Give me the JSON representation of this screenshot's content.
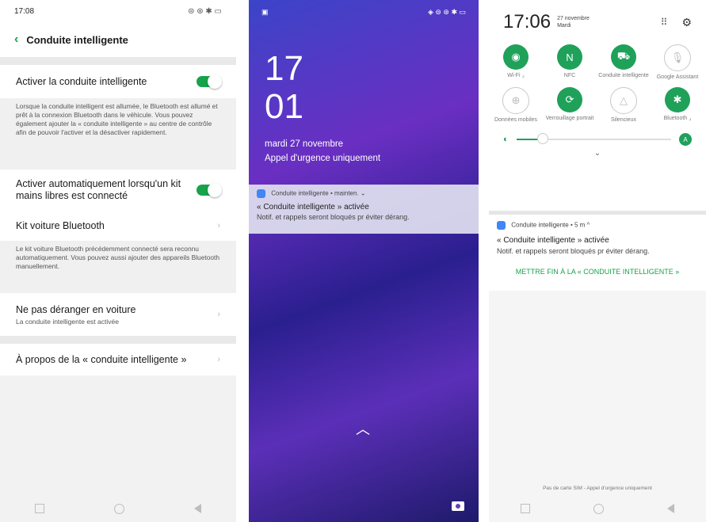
{
  "panel1": {
    "time": "17:08",
    "title": "Conduite intelligente",
    "toggle_label": "Activer la conduite intelligente",
    "toggle_desc": "Lorsque la conduite intelligent est allumée, le Bluetooth est allumé et prêt à la connexion Bluetooth dans le véhicule. Vous pouvez également ajouter la « conduite intelligente » au centre de contrôle afin de pouvoir l'activer et la désactiver rapidement.",
    "auto_label": "Activer automatiquement lorsqu'un kit mains libres est connecté",
    "kit_label": "Kit voiture Bluetooth",
    "kit_desc": "Le kit voiture Bluetooth précédemment connecté sera reconnu automatiquement. Vous pouvez aussi ajouter des appareils Bluetooth manuellement.",
    "dnd_label": "Ne pas déranger en voiture",
    "dnd_sub": "La conduite intelligente est activée",
    "about_label": "À propos de la « conduite intelligente »"
  },
  "panel2": {
    "hour": "17",
    "minute": "01",
    "date": "mardi 27 novembre",
    "emergency": "Appel d'urgence uniquement",
    "notif_header": "Conduite intelligente • mainten. ⌄",
    "notif_title": "« Conduite intelligente » activée",
    "notif_body": "Notif. et rappels seront bloqués pr éviter dérang."
  },
  "panel3": {
    "time": "17:06",
    "date": "27 novembre",
    "day": "Mardi",
    "tiles": [
      {
        "label": "Wi-Fi ⌟",
        "icon": "wifi-icon",
        "on": true,
        "glyph": "◉"
      },
      {
        "label": "NFC",
        "icon": "nfc-icon",
        "on": true,
        "glyph": "N"
      },
      {
        "label": "Conduite intelligente",
        "icon": "car-icon",
        "on": true,
        "glyph": "⛟"
      },
      {
        "label": "Google Assistant",
        "icon": "mic-icon",
        "on": false,
        "glyph": "🎙"
      },
      {
        "label": "Données mobiles",
        "icon": "globe-icon",
        "on": false,
        "glyph": "⊕"
      },
      {
        "label": "Verrouillage portrait",
        "icon": "rotation-lock-icon",
        "on": true,
        "glyph": "⟳"
      },
      {
        "label": "Silencieux",
        "icon": "bell-off-icon",
        "on": false,
        "glyph": "△"
      },
      {
        "label": "Bluetooth ⌟",
        "icon": "bluetooth-icon",
        "on": true,
        "glyph": "✱"
      }
    ],
    "brightness_auto": "A",
    "brightness_level": 0.17,
    "notif_header": "Conduite intelligente • 5 m ^",
    "notif_title": "« Conduite intelligente » activée",
    "notif_body": "Notif. et rappels seront bloqués pr éviter dérang.",
    "action": "METTRE FIN À LA « CONDUITE INTELLIGENTE »",
    "sim_text": "Pas de carte SIM - Appel d'urgence uniquement"
  },
  "colors": {
    "accent": "#16a34a"
  }
}
